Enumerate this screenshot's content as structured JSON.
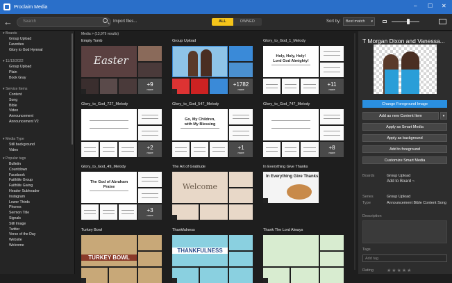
{
  "app": {
    "title": "Proclaim Media"
  },
  "toolbar": {
    "search_placeholder": "Search",
    "import_label": "Import files...",
    "filter_all": "ALL",
    "filter_owned": "OWNED",
    "sort_label": "Sort by:",
    "sort_value": "Best match",
    "size_slider_fraction": 0.6
  },
  "sidebar": {
    "sections": [
      {
        "label": "Boards",
        "items": [
          "Group Upload",
          "Favorites",
          "Glory to God Hymnal"
        ]
      },
      {
        "label": "11/13/2022",
        "items": [
          "Group Upload",
          "Plain",
          "Book Gray"
        ]
      },
      {
        "label": "Service Items",
        "items": [
          "Content",
          "Song",
          "Bible",
          "Video",
          "Announcement",
          "Announcement V2"
        ]
      },
      {
        "label": "Media Type",
        "items": [
          "Still background",
          "Video"
        ]
      },
      {
        "label": "Popular tags",
        "items": [
          "Bulletin",
          "Countdown",
          "Facebook",
          "Faithlife Group",
          "Faithlife Giving",
          "Header Subheader",
          "Instagram",
          "Lower Thirds",
          "Phones",
          "Sermon Title",
          "Signals",
          "Still Image",
          "Twitter",
          "Verse of the Day",
          "Website",
          "Welcome"
        ]
      }
    ]
  },
  "main": {
    "breadcrumb": "Media >",
    "result_count": "(13,979 results)",
    "more_label": "more",
    "cards": [
      {
        "title": "Empty Tomb",
        "more": "+9",
        "text": "Easter"
      },
      {
        "title": "Group Upload",
        "more": "+1782",
        "text": ""
      },
      {
        "title": "Glory_to_God_1_Melody",
        "more": "+11",
        "text": "Holy, Holy, Holy! Lord God Almighty!"
      },
      {
        "title": "Glory_to_God_727_Melody",
        "more": "+2",
        "text": ""
      },
      {
        "title": "Glory_to_God_547_Melody",
        "more": "+1",
        "text": "Go, My Children, with My Blessing"
      },
      {
        "title": "Glory_to_God_747_Melody",
        "more": "+8",
        "text": ""
      },
      {
        "title": "Glory_to_God_49_Melody",
        "more": "+3",
        "text": "The God of Abraham Praise"
      },
      {
        "title": "The Art of Gratitude",
        "more": "",
        "text": "Welcome"
      },
      {
        "title": "In Everything Give Thanks",
        "more": "",
        "text": "In Everything Give Thanks"
      },
      {
        "title": "Turkey Bowl",
        "more": "",
        "text": "TURKEY BOWL"
      },
      {
        "title": "Thankfulness",
        "more": "",
        "text": "THANKFULNESS"
      },
      {
        "title": "Thank The Lord Always",
        "more": "",
        "text": ""
      }
    ]
  },
  "panel": {
    "title": "T Morgan Dixon and Vanessa...",
    "buttons": [
      "Change Foreground Image",
      "Add as new Content Item",
      "Apply as Smart Media",
      "Apply as background",
      "Add to foreground",
      "Customize Smart Media"
    ],
    "boards_label": "Boards",
    "boards_value": "Group Upload",
    "add_to_board": "Add to Board ~",
    "series_label": "Series",
    "series_value": "Group Upload",
    "type_label": "Type",
    "type_value": "Announcement Bible Content Song",
    "description_label": "Description",
    "tags_label": "Tags",
    "tag_placeholder": "Add tag",
    "rating_label": "Rating",
    "rating": 0
  },
  "colors": {
    "titlebar": "#2a6fc9",
    "accent": "#f5c41a",
    "primary_button": "#2a8fe0"
  }
}
